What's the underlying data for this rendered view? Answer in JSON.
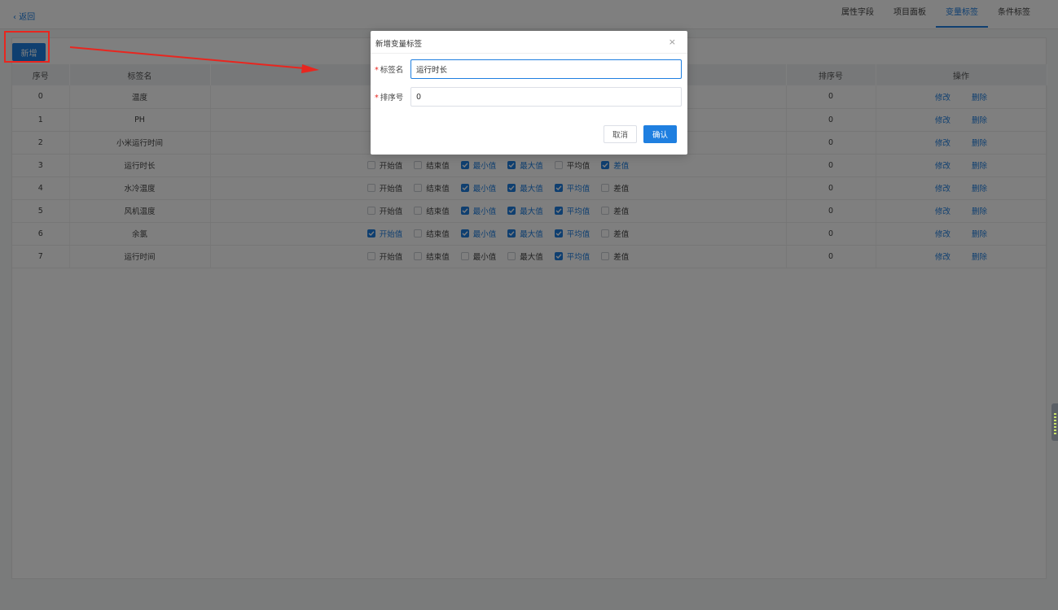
{
  "header": {
    "back_label": "返回",
    "tabs": [
      {
        "label": "属性字段",
        "active": false
      },
      {
        "label": "项目面板",
        "active": false
      },
      {
        "label": "变量标签",
        "active": true
      },
      {
        "label": "条件标签",
        "active": false
      }
    ]
  },
  "toolbar": {
    "add_label": "新增"
  },
  "table": {
    "columns": [
      "序号",
      "标签名",
      "",
      "排序号",
      "操作"
    ],
    "checkbox_labels": [
      "开始值",
      "结束值",
      "最小值",
      "最大值",
      "平均值",
      "差值"
    ],
    "rows": [
      {
        "index": "0",
        "name": "温度",
        "order": "0",
        "checks": null
      },
      {
        "index": "1",
        "name": "PH",
        "order": "0",
        "checks": null
      },
      {
        "index": "2",
        "name": "小米运行时间",
        "order": "0",
        "checks": null
      },
      {
        "index": "3",
        "name": "运行时长",
        "order": "0",
        "checks": [
          false,
          false,
          true,
          true,
          false,
          true
        ]
      },
      {
        "index": "4",
        "name": "水冷温度",
        "order": "0",
        "checks": [
          false,
          false,
          true,
          true,
          true,
          false
        ]
      },
      {
        "index": "5",
        "name": "风机温度",
        "order": "0",
        "checks": [
          false,
          false,
          true,
          true,
          true,
          false
        ]
      },
      {
        "index": "6",
        "name": "余氯",
        "order": "0",
        "checks": [
          true,
          false,
          true,
          true,
          true,
          false
        ]
      },
      {
        "index": "7",
        "name": "运行时间",
        "order": "0",
        "checks": [
          false,
          false,
          false,
          false,
          true,
          false
        ]
      }
    ],
    "edit_label": "修改",
    "delete_label": "删除"
  },
  "dialog": {
    "title": "新增变量标签",
    "close_glyph": "×",
    "name_label": "标签名",
    "name_value": "运行时长",
    "order_label": "排序号",
    "order_value": "0",
    "required_mark": "*",
    "cancel_label": "取消",
    "confirm_label": "确认"
  },
  "colors": {
    "accent": "#1f7fe0",
    "annotation": "#e8261f"
  }
}
